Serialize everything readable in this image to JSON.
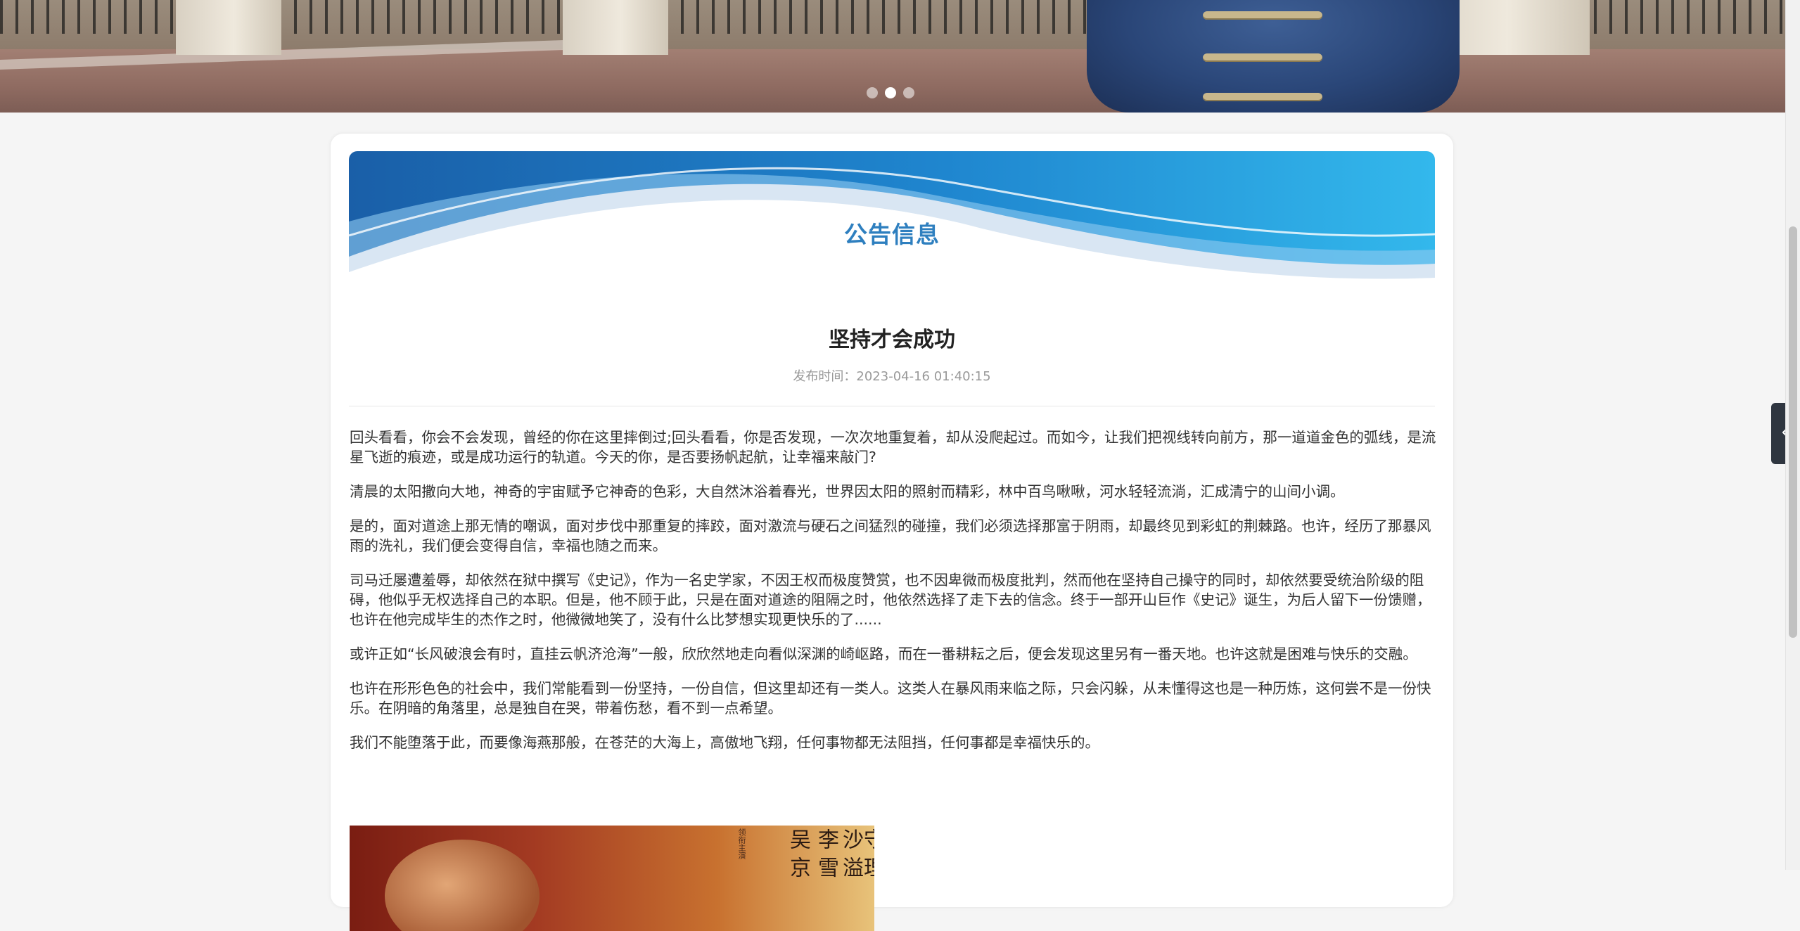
{
  "carousel": {
    "slide_count": 3,
    "active_index": 1
  },
  "notice": {
    "banner_title": "公告信息",
    "article_title": "坚持才会成功",
    "publish_time": "发布时间：2023-04-16 01:40:15",
    "paragraphs": [
      "回头看看，你会不会发现，曾经的你在这里摔倒过;回头看看，你是否发现，一次次地重复着，却从没爬起过。而如今，让我们把视线转向前方，那一道道金色的弧线，是流星飞逝的痕迹，或是成功运行的轨道。今天的你，是否要扬帆起航，让幸福来敲门?",
      "清晨的太阳撒向大地，神奇的宇宙赋予它神奇的色彩，大自然沐浴着春光，世界因太阳的照射而精彩，林中百鸟啾啾，河水轻轻流淌，汇成清宁的山间小调。",
      "是的，面对道途上那无情的嘲讽，面对步伐中那重复的摔跤，面对激流与硬石之间猛烈的碰撞，我们必须选择那富于阴雨，却最终见到彩虹的荆棘路。也许，经历了那暴风雨的洗礼，我们便会变得自信，幸福也随之而来。",
      "司马迁屡遭羞辱，却依然在狱中撰写《史记》，作为一名史学家，不因王权而极度赞赏，也不因卑微而极度批判，然而他在坚持自己操守的同时，却依然要受统治阶级的阻碍，他似乎无权选择自己的本职。但是，他不顾于此，只是在面对道途的阻隔之时，他依然选择了走下去的信念。终于一部开山巨作《史记》诞生，为后人留下一份馈赠，也许在他完成毕生的杰作之时，他微微地笑了，没有什么比梦想实现更快乐的了......",
      "或许正如“长风破浪会有时，直挂云帆济沧海”一般，欣欣然地走向看似深渊的崎岖路，而在一番耕耘之后，便会发现这里另有一番天地。也许这就是困难与快乐的交融。",
      "也许在形形色色的社会中，我们常能看到一份坚持，一份自信，但这里却还有一类人。这类人在暴风雨来临之际，只会闪躲，从未懂得这也是一种历炼，这何尝不是一份快乐。在阴暗的角落里，总是独自在哭，带着伤愁，看不到一点希望。",
      "我们不能堕落于此，而要像海燕那般，在苍茫的大海上，高傲地飞翔，任何事物都无法阻挡，任何事都是幸福快乐的。"
    ]
  },
  "poster": {
    "calligraphy": [
      "守",
      "理",
      "沙",
      "溢",
      "李",
      "雪",
      "吴",
      "京"
    ],
    "small_text": "领衔主演"
  },
  "colors": {
    "banner_title": "#2e7fbf",
    "side_toggle": "#2f3640",
    "wave_primary": "#1f6fbf",
    "wave_light": "#39b9ee"
  },
  "icons": {
    "side_toggle": "chevron-left-icon"
  }
}
